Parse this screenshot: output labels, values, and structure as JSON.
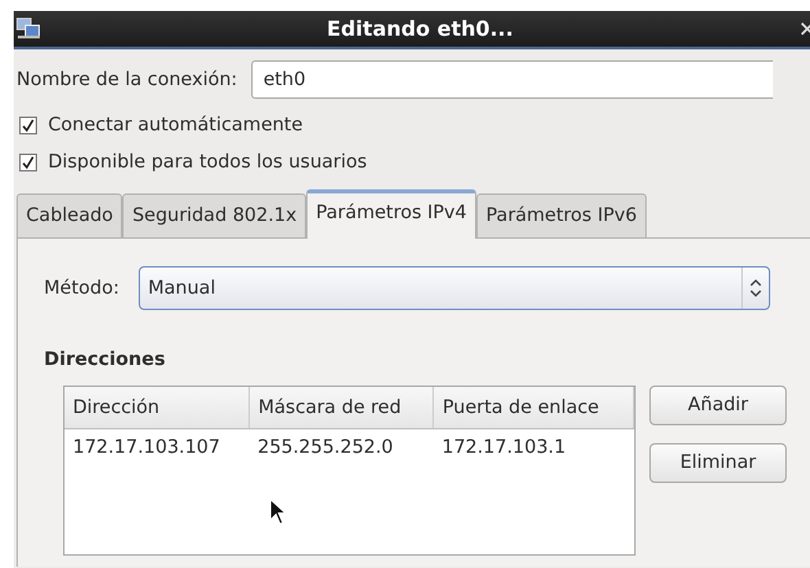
{
  "window": {
    "title": "Editando eth0..."
  },
  "connection_name": {
    "label": "Nombre de la conexión:",
    "value": "eth0"
  },
  "options": [
    {
      "label": "Conectar automáticamente",
      "checked": true
    },
    {
      "label": "Disponible para todos los usuarios",
      "checked": true
    }
  ],
  "tabs": [
    {
      "label": "Cableado",
      "selected": false
    },
    {
      "label": "Seguridad 802.1x",
      "selected": false
    },
    {
      "label": "Parámetros IPv4",
      "selected": true
    },
    {
      "label": "Parámetros IPv6",
      "selected": false
    }
  ],
  "method": {
    "label": "Método:",
    "value": "Manual"
  },
  "addresses": {
    "heading": "Direcciones",
    "columns": [
      "Dirección",
      "Máscara de red",
      "Puerta de enlace"
    ],
    "rows": [
      [
        "172.17.103.107",
        "255.255.252.0",
        "172.17.103.1"
      ]
    ],
    "buttons": [
      "Añadir",
      "Eliminar"
    ]
  }
}
